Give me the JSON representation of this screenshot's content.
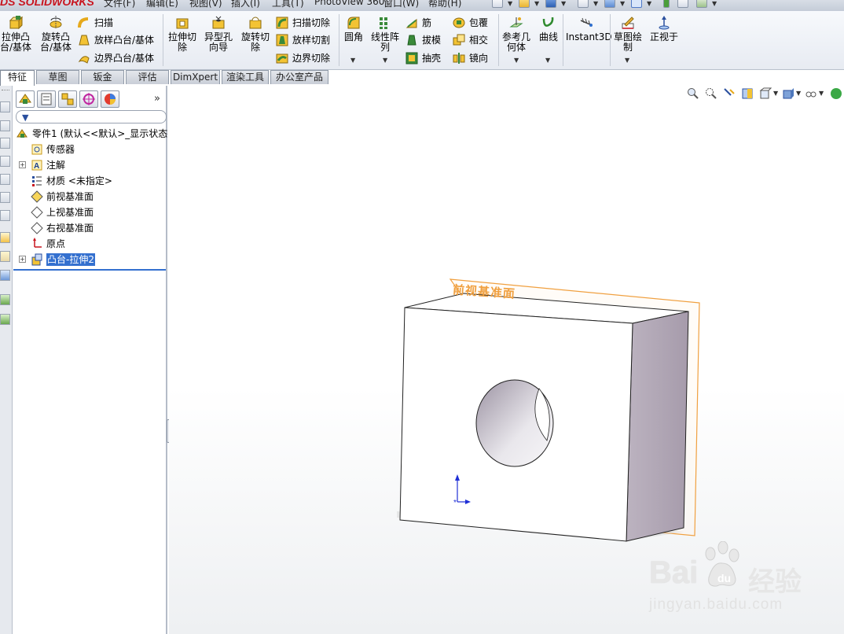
{
  "app": {
    "logo_text": "DS SOLIDWORKS",
    "menu": [
      "文件(F)",
      "编辑(E)",
      "视图(V)",
      "插入(I)",
      "工具(T)",
      "PhotoView 360",
      "窗口(W)",
      "帮助(H)"
    ]
  },
  "command_manager": {
    "extrude_boss": "拉伸凸\n台/基体",
    "revolve_boss": "旋转凸\n台/基体",
    "sweep": "扫描",
    "loft_boss": "放样凸台/基体",
    "boundary_boss": "边界凸台/基体",
    "extrude_cut": "拉伸切\n除",
    "hole_wizard": "异型孔\n向导",
    "revolve_cut": "旋转切\n除",
    "sweep_cut": "扫描切除",
    "loft_cut": "放样切割",
    "boundary_cut": "边界切除",
    "fillet": "圆角",
    "linear_pattern": "线性阵\n列",
    "rib": "筋",
    "draft": "拔模",
    "shell": "抽壳",
    "wrap": "包覆",
    "intersect": "相交",
    "mirror": "镜向",
    "reference_geometry": "参考几\n何体",
    "curves": "曲线",
    "instant3d": "Instant3D",
    "sketch": "草图绘\n制",
    "normal_to": "正视于"
  },
  "tabs": [
    "特征",
    "草图",
    "钣金",
    "评估",
    "DimXpert",
    "渲染工具",
    "办公室产品"
  ],
  "tree": {
    "part": "零件1 (默认<<默认>_显示状态",
    "sensors": "传感器",
    "annotations": "注解",
    "material": "材质 <未指定>",
    "front_plane": "前视基准面",
    "top_plane": "上视基准面",
    "right_plane": "右视基准面",
    "origin": "原点",
    "boss_extrude": "凸台-拉伸2"
  },
  "viewport": {
    "plane_label": "前视基准面"
  },
  "watermark": {
    "brand": "Bai",
    "brand2": "经验",
    "url": "jingyan.baidu.com"
  },
  "colors": {
    "accent": "#3470cf",
    "plane": "#f0a040",
    "logo_red": "#c8141e"
  }
}
